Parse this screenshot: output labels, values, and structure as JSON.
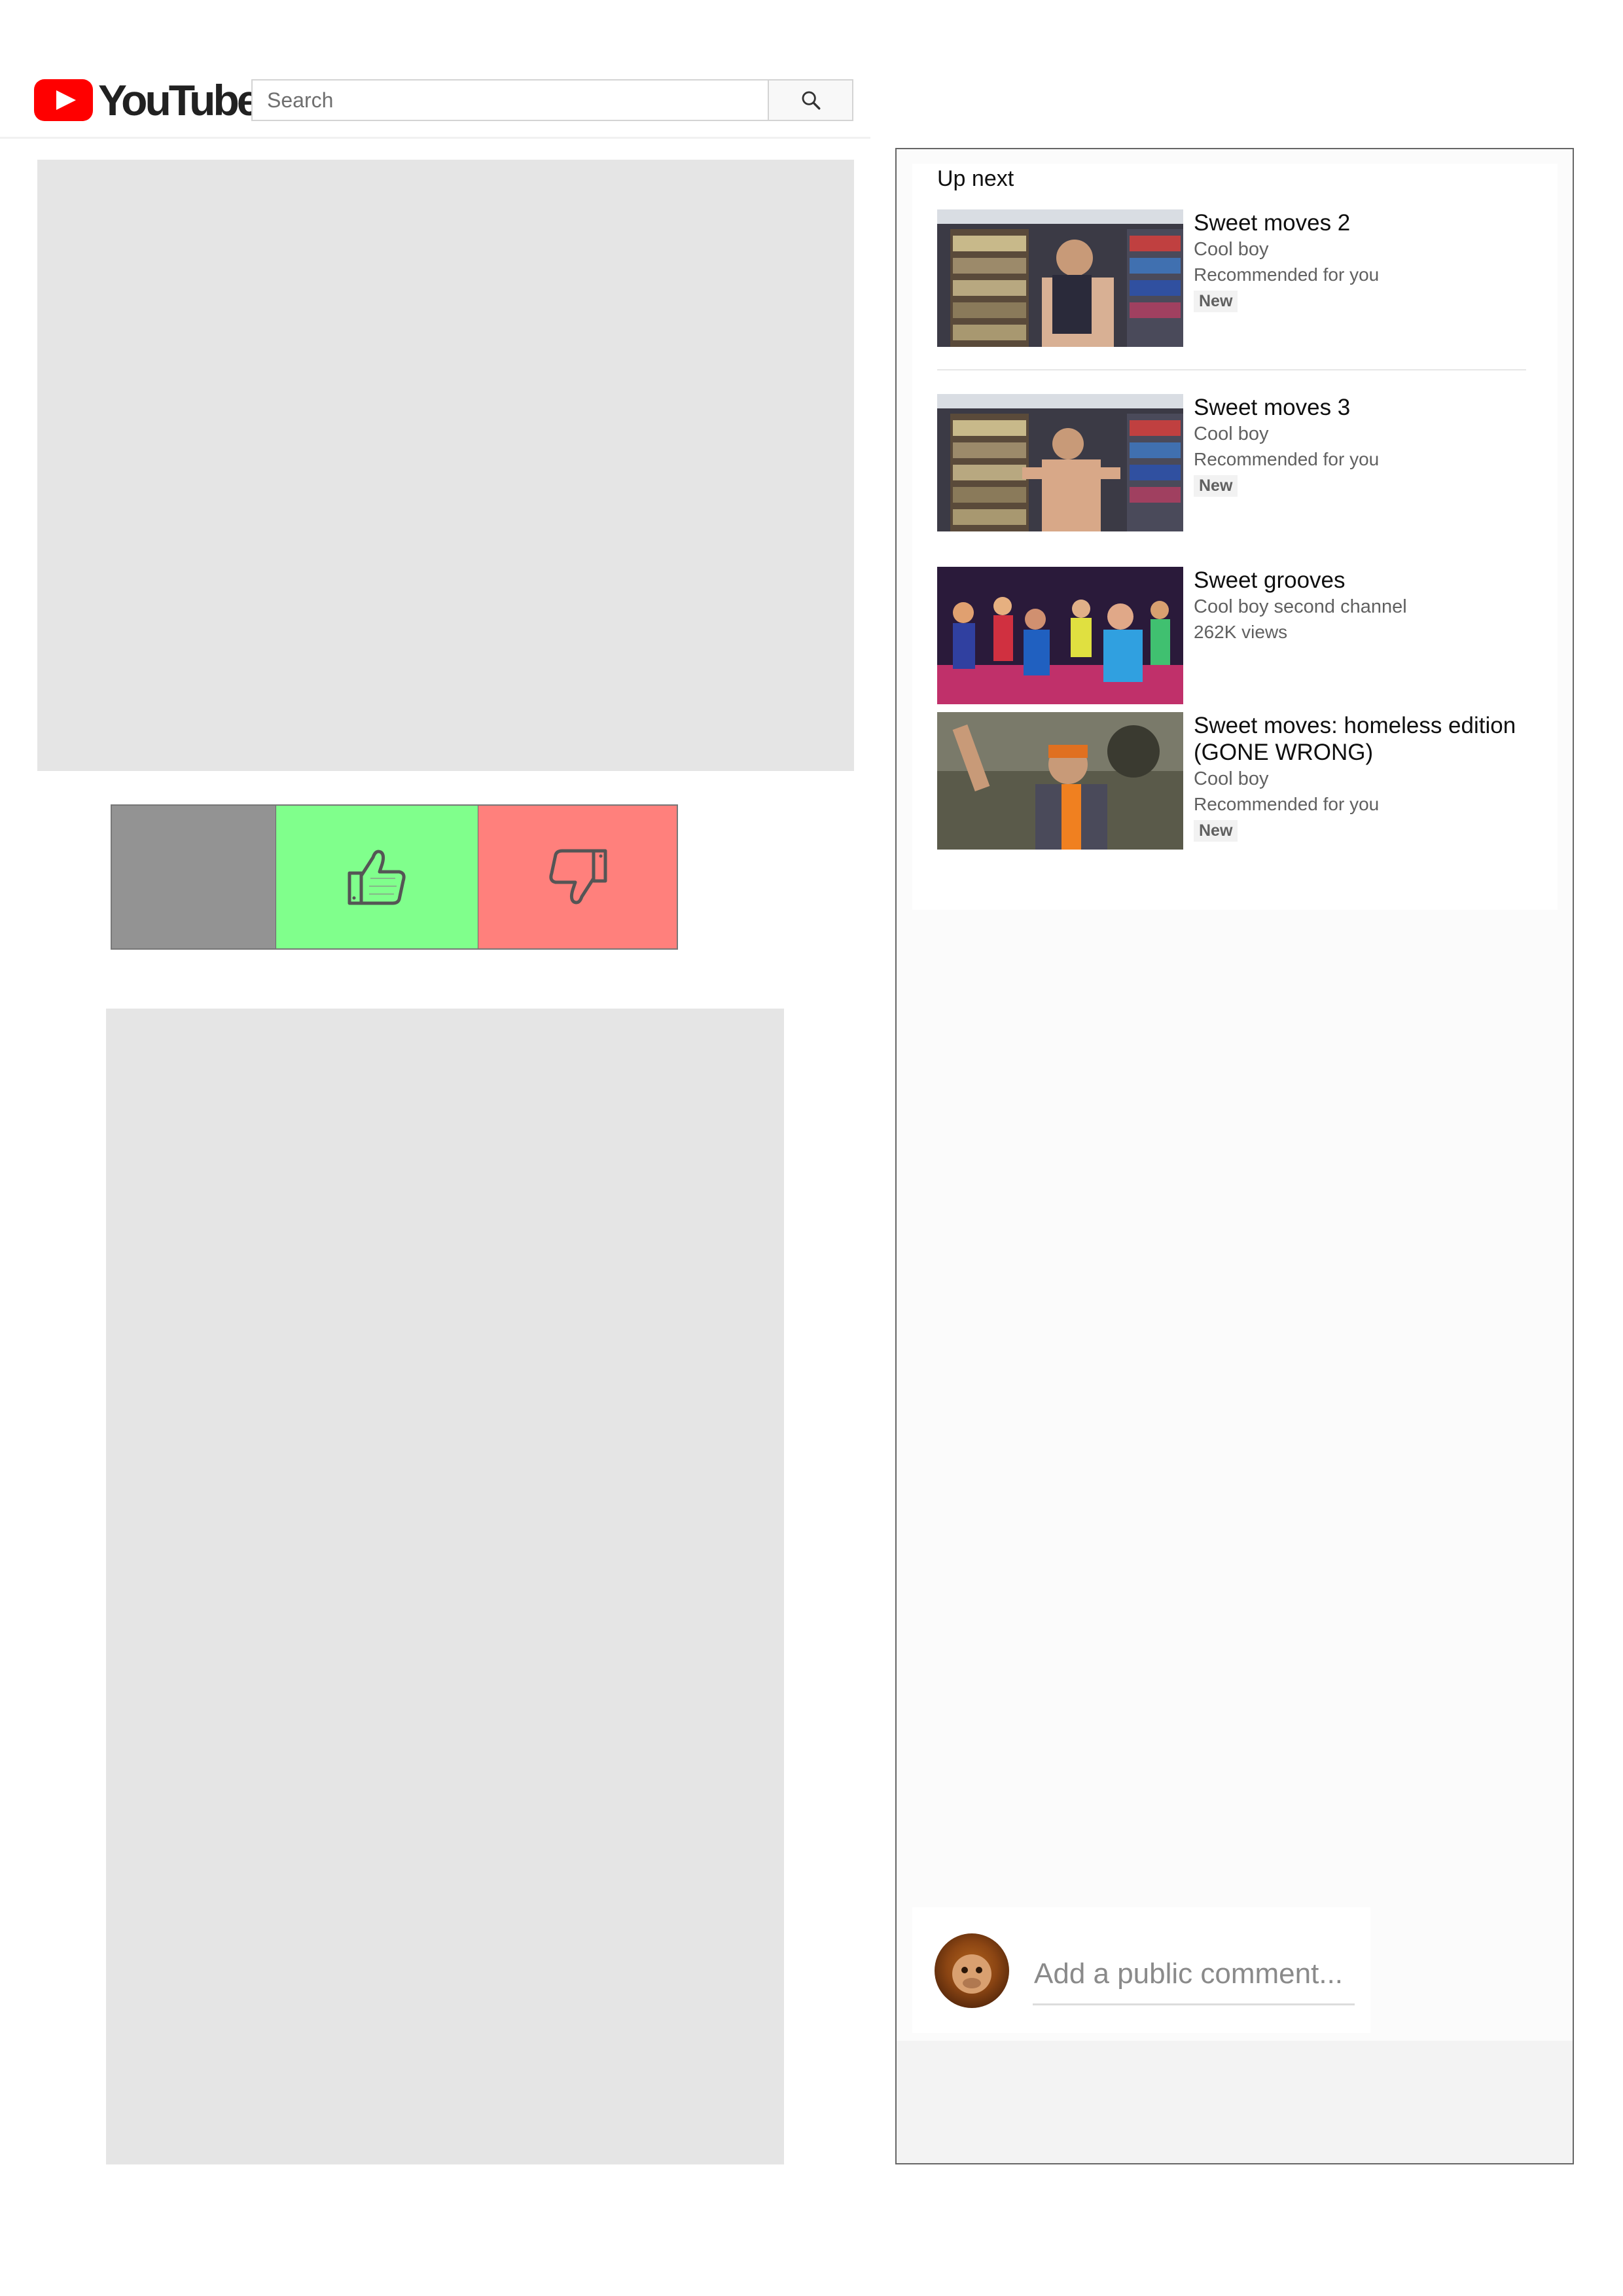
{
  "header": {
    "logo_text": "YouTube",
    "search_placeholder": "Search"
  },
  "icons": {
    "search": "search-icon",
    "like": "thumbs-up-icon",
    "dislike": "thumbs-down-icon"
  },
  "colors": {
    "brand_red": "#ff0000",
    "like_green": "#80ff8c",
    "dislike_red": "#ff807c",
    "neutral_gray": "#939393",
    "placeholder_gray": "#e5e5e5"
  },
  "up_next": {
    "title": "Up next",
    "videos": [
      {
        "title": "Sweet moves 2",
        "channel": "Cool boy",
        "sub": "Recommended for you",
        "badge": "New"
      },
      {
        "title": "Sweet moves 3",
        "channel": "Cool boy",
        "sub": "Recommended for you",
        "badge": "New"
      },
      {
        "title": "Sweet grooves",
        "channel": "Cool boy second channel",
        "sub": "262K views",
        "badge": ""
      },
      {
        "title": "Sweet moves: homeless edition (GONE WRONG)",
        "channel": "Cool boy",
        "sub": "Recommended for you",
        "badge": "New"
      }
    ]
  },
  "comments": {
    "placeholder": "Add a public comment..."
  }
}
